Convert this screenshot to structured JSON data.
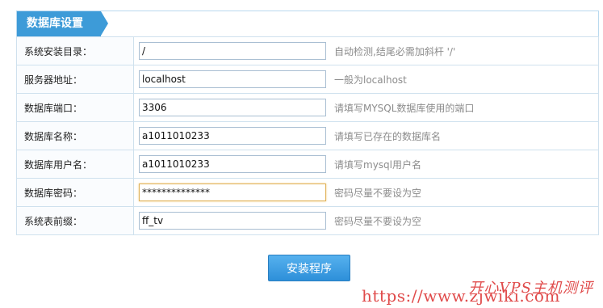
{
  "panel": {
    "title": "数据库设置"
  },
  "form": {
    "rows": [
      {
        "label": "系统安装目录：",
        "value": "/",
        "hint": "自动检测,结尾必需加斜杆 '/'"
      },
      {
        "label": "服务器地址：",
        "value": "localhost",
        "hint": "一般为localhost"
      },
      {
        "label": "数据库端口：",
        "value": "3306",
        "hint": "请填写MYSQL数据库使用的端口"
      },
      {
        "label": "数据库名称：",
        "value": "a1011010233",
        "hint": "请填写已存在的数据库名"
      },
      {
        "label": "数据库用户名：",
        "value": "a1011010233",
        "hint": "请填写mysql用户名"
      },
      {
        "label": "数据库密码：",
        "value": "**************",
        "hint": "密码尽量不要设为空"
      },
      {
        "label": "系统表前缀：",
        "value": "ff_tv",
        "hint": "密码尽量不要设为空"
      }
    ]
  },
  "actions": {
    "install_label": "安装程序"
  },
  "watermark": {
    "name": "开心VPS主机测评",
    "url": "https://www.zjwiki.com"
  }
}
